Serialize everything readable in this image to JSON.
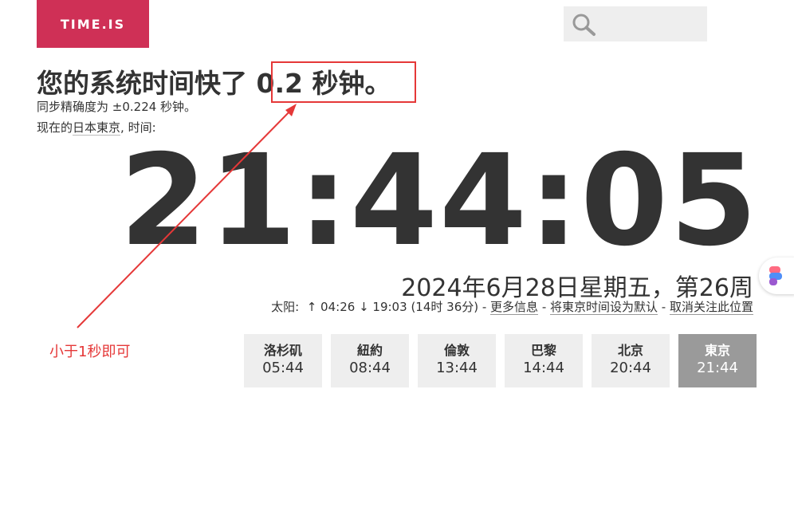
{
  "header": {
    "logo_text": "TIME.IS",
    "search_placeholder": ""
  },
  "headline": {
    "prefix": "您的系统时间快了 ",
    "value": "0.2 秒钟。"
  },
  "sync_line": "同步精确度为 ±0.224 秒钟。",
  "now_in": {
    "prefix": "现在的",
    "location": "日本東京",
    "suffix": ", 时间:"
  },
  "clock": "21:44:05",
  "date_line": "2024年6月28日星期五，第26周",
  "sun_info": {
    "label": "太阳:",
    "sunrise": "↑ 04:26",
    "sunset": "↓ 19:03",
    "daylight": "(14时 36分)",
    "more_info": "更多信息",
    "set_default": "将東京时间设为默认",
    "unfollow": "取消关注此位置",
    "separator": " - "
  },
  "cities": [
    {
      "name": "洛杉矶",
      "time": "05:44"
    },
    {
      "name": "紐約",
      "time": "08:44"
    },
    {
      "name": "倫敦",
      "time": "13:44"
    },
    {
      "name": "巴黎",
      "time": "14:44"
    },
    {
      "name": "北京",
      "time": "20:44"
    },
    {
      "name": "東京",
      "time": "21:44"
    }
  ],
  "annotation": {
    "text": "小于1秒即可",
    "color": "#e53838"
  },
  "colors": {
    "brand": "#cf3056",
    "active_city": "#9a9a9a"
  },
  "icons": {
    "search": "search-icon",
    "side": "extension-icon"
  }
}
